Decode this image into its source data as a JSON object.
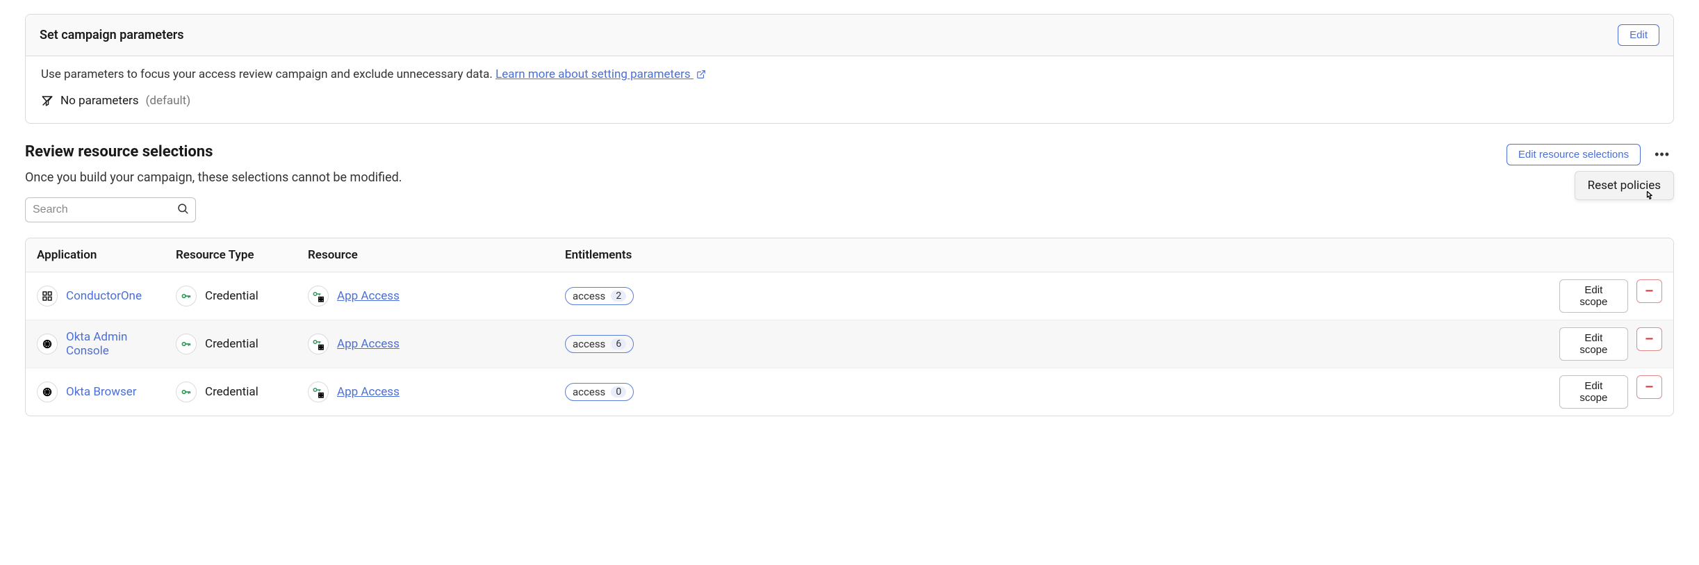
{
  "campaign_params": {
    "title": "Set campaign parameters",
    "edit_label": "Edit",
    "description": "Use parameters to focus your access review campaign and exclude unnecessary data. ",
    "learn_more": "Learn more about setting parameters",
    "no_params_label": "No parameters",
    "default_label": "(default)"
  },
  "resources": {
    "title": "Review resource selections",
    "subtitle": "Once you build your campaign, these selections cannot be modified.",
    "edit_selections_label": "Edit resource selections",
    "popover_reset": "Reset policies",
    "search_placeholder": "Search",
    "columns": {
      "application": "Application",
      "resource_type": "Resource Type",
      "resource": "Resource",
      "entitlements": "Entitlements"
    },
    "edit_scope_label": "Edit scope",
    "rows": [
      {
        "app_name": "ConductorOne",
        "resource_type": "Credential",
        "resource": "App Access",
        "entitlement_label": "access",
        "entitlement_count": "2"
      },
      {
        "app_name": "Okta Admin Console",
        "resource_type": "Credential",
        "resource": "App Access",
        "entitlement_label": "access",
        "entitlement_count": "6"
      },
      {
        "app_name": "Okta Browser",
        "resource_type": "Credential",
        "resource": "App Access",
        "entitlement_label": "access",
        "entitlement_count": "0"
      }
    ]
  }
}
